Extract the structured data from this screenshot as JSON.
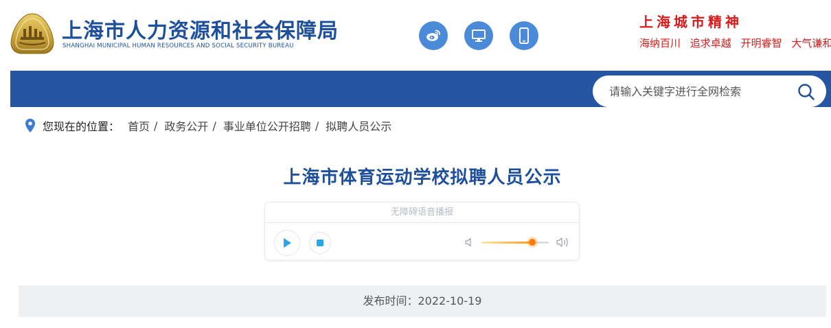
{
  "header": {
    "logo_cn": "上海市人力资源和社会保障局",
    "logo_en": "SHANGHAI MUNICIPAL HUMAN RESOURCES AND SOCIAL SECURITY BUREAU",
    "icons": [
      "weibo-icon",
      "desktop-icon",
      "mobile-icon"
    ],
    "spirit_title": "上海城市精神",
    "spirit_words": [
      "海纳百川",
      "追求卓越",
      "开明睿智",
      "大气谦和"
    ]
  },
  "search": {
    "placeholder": "请输入关键字进行全网检索"
  },
  "breadcrumb": {
    "label": "您现在的位置：",
    "items": [
      "首页",
      "政务公开",
      "事业单位公开招聘",
      "拟聘人员公示"
    ],
    "separator": "/"
  },
  "article": {
    "title": "上海市体育运动学校拟聘人员公示",
    "publish_date": "发布时间：2022-10-19"
  },
  "player": {
    "header_label": "无障碍语音播报",
    "volume_fraction": 0.76
  },
  "colors": {
    "brand_blue": "#2655a3",
    "title_blue": "#1e4f9c",
    "icon_blue": "#4a8ad8",
    "spirit_red": "#d71a1a",
    "play_accent": "#2aa7e8",
    "volume_orange": "#ff7a00"
  }
}
